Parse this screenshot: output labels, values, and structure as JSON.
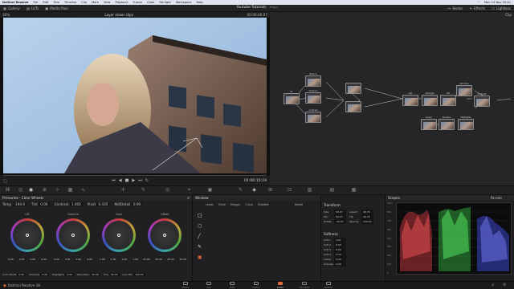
{
  "menubar": {
    "items": [
      "DaVinci Resolve",
      "File",
      "Edit",
      "Trim",
      "Timeline",
      "Clip",
      "Mark",
      "View",
      "Playback",
      "Fusion",
      "Color",
      "Fairlight",
      "Workspace",
      "Help"
    ],
    "clock": "Mon 14 Nov 20:41"
  },
  "toolbar": {
    "left": [
      "Gallery",
      "LUTs",
      "Media Pool"
    ],
    "project_title": "Youtube Tutorials",
    "project_status": "Edited",
    "right": [
      "Nodes",
      "Effects",
      "Lightbox"
    ]
  },
  "viewer": {
    "zoom": "30%",
    "clip_name": "Layer mixer clips",
    "timecode_top": "00:00:46:07",
    "timecode": "01:00:15:19"
  },
  "nodes": {
    "mode": "Clip",
    "items": [
      {
        "id": "01",
        "label": ""
      },
      {
        "id": "02",
        "label": "Texture"
      },
      {
        "id": "03",
        "label": "Sharpen"
      },
      {
        "id": "04",
        "label": "Contrast"
      },
      {
        "id": "05",
        "label": ""
      },
      {
        "id": "06",
        "label": ""
      },
      {
        "id": "07",
        "label": "Sat"
      },
      {
        "id": "08",
        "label": "Daylight"
      },
      {
        "id": "09",
        "label": "Lift"
      },
      {
        "id": "10",
        "label": "Skintone"
      },
      {
        "id": "11",
        "label": "Contrast"
      },
      {
        "id": "12",
        "label": "Green"
      },
      {
        "id": "13",
        "label": "Shadow"
      },
      {
        "id": "14",
        "label": "Highlights"
      }
    ]
  },
  "primaries": {
    "title": "Primaries - Color Wheels",
    "params": [
      {
        "label": "Temp",
        "value": "-194.0"
      },
      {
        "label": "Tint",
        "value": "0.00"
      },
      {
        "label": "Contrast",
        "value": "1.000"
      },
      {
        "label": "Pivot",
        "value": "0.435"
      },
      {
        "label": "Md/Detail",
        "value": "0.00"
      }
    ],
    "wheels": [
      {
        "name": "Lift",
        "vals": [
          "0.00",
          "0.00",
          "0.00",
          "0.00"
        ]
      },
      {
        "name": "Gamma",
        "vals": [
          "0.00",
          "0.00",
          "0.00",
          "0.00"
        ]
      },
      {
        "name": "Gain",
        "vals": [
          "1.00",
          "1.00",
          "1.00",
          "1.00"
        ]
      },
      {
        "name": "Offset",
        "vals": [
          "25.00",
          "25.00",
          "25.00",
          "25.00"
        ]
      }
    ],
    "bottom": [
      {
        "label": "Color Boost",
        "value": "0.00"
      },
      {
        "label": "Shadows",
        "value": "0.00"
      },
      {
        "label": "Highlights",
        "value": "0.00"
      },
      {
        "label": "Saturation",
        "value": "50.00"
      },
      {
        "label": "Hue",
        "value": "50.00"
      },
      {
        "label": "Lum Mix",
        "value": "100.00"
      }
    ]
  },
  "window_panel": {
    "title": "Window",
    "tabs": [
      "Linear",
      "Circle",
      "Polygon",
      "Curve",
      "Gradient"
    ],
    "delete_label": "Delete"
  },
  "transform": {
    "title": "Transform",
    "rows": [
      {
        "l1": "Size",
        "v1": "50.27",
        "l2": "Aspect",
        "v2": "48.76"
      },
      {
        "l1": "Pan",
        "v1": "50.27",
        "l2": "Tilt",
        "v2": "48.76"
      },
      {
        "l1": "Rotate",
        "v1": "-30.97",
        "l2": "Opacity",
        "v2": "100.00"
      }
    ],
    "softness_title": "Softness",
    "softness": [
      {
        "label": "Soft 1",
        "value": "4.67"
      },
      {
        "label": "Soft 2",
        "value": "0.50"
      },
      {
        "label": "Soft 3",
        "value": "0.50"
      },
      {
        "label": "Soft 4",
        "value": "0.50"
      },
      {
        "label": "Inside",
        "value": "0.00"
      },
      {
        "label": "Outside",
        "value": "0.00"
      }
    ]
  },
  "scopes": {
    "title": "Scopes",
    "mode": "Parade",
    "ticks": [
      "1023",
      "896",
      "768",
      "640",
      "512",
      "384",
      "256",
      "128",
      "0"
    ]
  },
  "status": {
    "app": "DaVinci Resolve 18",
    "pages": [
      "Media",
      "Cut",
      "Edit",
      "Fusion",
      "Color",
      "Fairlight",
      "Deliver"
    ],
    "active_page": "Color"
  },
  "colors": {
    "accent": "#e06b3a",
    "sky": "#a9c6e4"
  }
}
